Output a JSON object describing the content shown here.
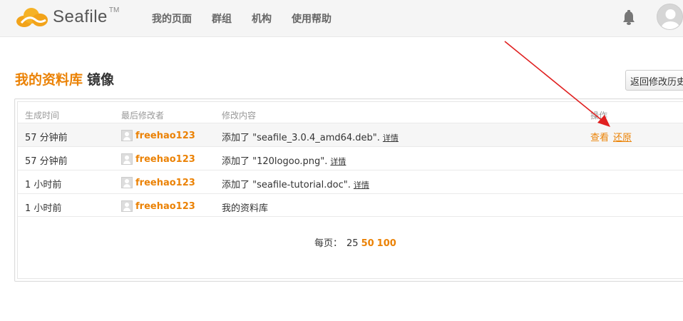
{
  "header": {
    "logo_text": "Seafile",
    "logo_tm": "TM",
    "nav": [
      "我的页面",
      "群组",
      "机构",
      "使用帮助"
    ]
  },
  "page": {
    "repo_name": "我的资料库",
    "title_suffix": "镜像",
    "back_button": "返回修改历史"
  },
  "table": {
    "headers": [
      "生成时间",
      "最后修改者",
      "修改内容",
      "操作"
    ],
    "rows": [
      {
        "time": "57 分钟前",
        "user": "freehao123",
        "desc": "添加了 \"seafile_3.0.4_amd64.deb\".",
        "detail": "详情",
        "ops": [
          "查看",
          "还原"
        ]
      },
      {
        "time": "57 分钟前",
        "user": "freehao123",
        "desc": "添加了 \"120logoo.png\".",
        "detail": "详情"
      },
      {
        "time": "1 小时前",
        "user": "freehao123",
        "desc": "添加了 \"seafile-tutorial.doc\".",
        "detail": "详情"
      },
      {
        "time": "1 小时前",
        "user": "freehao123",
        "desc": "我的资料库"
      }
    ]
  },
  "pager": {
    "label": "每页：",
    "current": "25",
    "options": [
      "50",
      "100"
    ]
  },
  "colors": {
    "accent": "#eb8205",
    "arrow": "#e02020"
  }
}
